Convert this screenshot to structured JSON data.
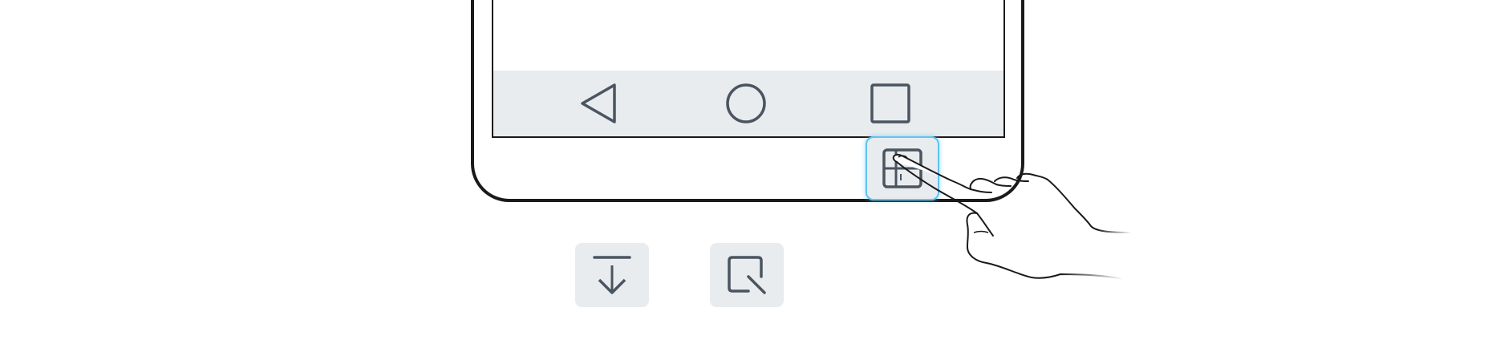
{
  "navigation": {
    "back_icon": "back-triangle-icon",
    "home_icon": "home-circle-icon",
    "recent_icon": "recent-square-icon"
  },
  "split_key": {
    "icon": "split-screen-icon",
    "highlight_color": "#5ec3f2"
  },
  "options": [
    {
      "icon": "download-arrow-icon"
    },
    {
      "icon": "crop-square-icon"
    }
  ],
  "colors": {
    "stroke": "#4a5560",
    "nav_background": "#e9ecef",
    "outline": "#1a1a1a"
  }
}
